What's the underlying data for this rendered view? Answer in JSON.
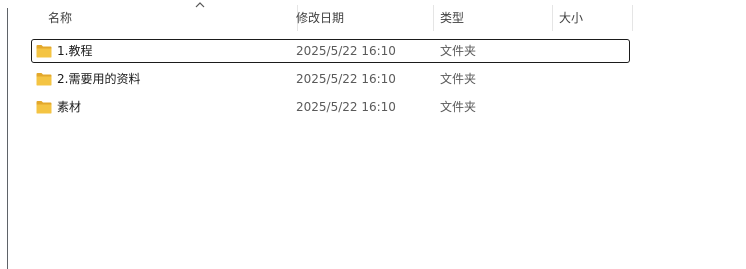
{
  "columns": {
    "name": "名称",
    "date": "修改日期",
    "type": "类型",
    "size": "大小"
  },
  "sort": {
    "column": "name",
    "direction": "ascending"
  },
  "files": [
    {
      "name": "1.教程",
      "date": "2025/5/22 16:10",
      "type": "文件夹",
      "size": "",
      "selected": true
    },
    {
      "name": "2.需要用的资料",
      "date": "2025/5/22 16:10",
      "type": "文件夹",
      "size": "",
      "selected": false
    },
    {
      "name": "素材",
      "date": "2025/5/22 16:10",
      "type": "文件夹",
      "size": "",
      "selected": false
    }
  ],
  "icons": {
    "folder": "folder-icon",
    "sort": "sort-up-icon"
  },
  "colors": {
    "folder": "#f4c443",
    "folder_dark": "#e3a82b",
    "selection_border": "#1b1b1b"
  }
}
